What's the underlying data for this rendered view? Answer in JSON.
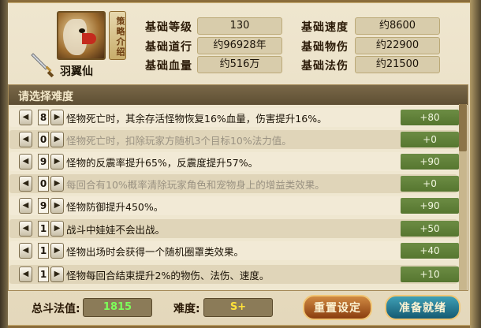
{
  "character": {
    "name": "羽翼仙",
    "strategy_label": "策略介绍",
    "stats": {
      "level_label": "基础等级",
      "level": "130",
      "speed_label": "基础速度",
      "speed": "约8600",
      "daoxing_label": "基础道行",
      "daoxing": "约96928年",
      "phys_label": "基础物伤",
      "phys": "约22900",
      "hp_label": "基础血量",
      "hp": "约516万",
      "magic_label": "基础法伤",
      "magic": "约21500"
    }
  },
  "difficulty_panel": {
    "title": "请选择难度",
    "rows": [
      {
        "level": "8",
        "text": "怪物死亡时，其余存活怪物恢复16%血量，伤害提升16%。",
        "bonus": "+80",
        "dim": false
      },
      {
        "level": "0",
        "text": "怪物死亡时，扣除玩家方随机3个目标10%法力值。",
        "bonus": "+0",
        "dim": true
      },
      {
        "level": "9",
        "text": "怪物的反震率提升65%，反震度提升57%。",
        "bonus": "+90",
        "dim": false
      },
      {
        "level": "0",
        "text": "每回合有10%概率清除玩家角色和宠物身上的增益类效果。",
        "bonus": "+0",
        "dim": true
      },
      {
        "level": "9",
        "text": "怪物防御提升450%。",
        "bonus": "+90",
        "dim": false
      },
      {
        "level": "1",
        "text": "战斗中娃娃不会出战。",
        "bonus": "+50",
        "dim": false
      },
      {
        "level": "1",
        "text": "怪物出场时会获得一个随机圈罩类效果。",
        "bonus": "+40",
        "dim": false
      },
      {
        "level": "1",
        "text": "怪物每回合结束提升2%的物伤、法伤、速度。",
        "bonus": "+10",
        "dim": false
      }
    ]
  },
  "footer": {
    "total_label": "总斗法值:",
    "total_value": "1815",
    "difficulty_label": "难度:",
    "difficulty_value": "S+",
    "reset_button": "重置设定",
    "ready_button": "准备就绪"
  },
  "colors": {
    "total_value": "#7dff5a",
    "difficulty_value": "#ffe23a",
    "bonus_bg": "#5f7f38"
  }
}
